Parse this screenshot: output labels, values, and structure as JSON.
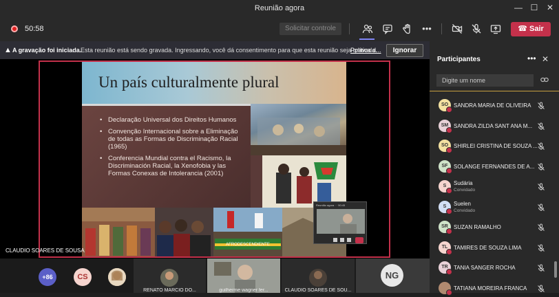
{
  "window": {
    "title": "Reunião agora",
    "minimize": "—",
    "maximize": "☐",
    "close": "✕"
  },
  "toolbar": {
    "timer": "50:58",
    "request_control": "Solicitar controle",
    "leave_label": "Sair"
  },
  "banner": {
    "bold": "A gravação foi iniciada.",
    "text": "Esta reunião está sendo gravada. Ingressando, você dá consentimento para que esta reunião seja gravada.",
    "link": "Política d...",
    "ignore": "Ignorar"
  },
  "slide": {
    "title": "Un país culturalmente plural",
    "bullets": [
      "Declaração Universal dos Direitos Humanos",
      "Convenção Internacional sobre a Eliminação de todas as Formas de Discriminação Racial (1965)",
      "Conferencia Mundial contra el Racismo, la Discriminación Racial, la Xenofobia y las Formas Conexas de Intolerancia (2001)"
    ],
    "banner_text": "AFRODESCENDIENTE"
  },
  "mini_window": {
    "title": "Reunião agora  ·  ·  50:45"
  },
  "speaker_label": "CLAUDIO SOARES DE SOUSA",
  "gallery": {
    "more_count": "+86",
    "cs": "CS",
    "ng": "NG",
    "tiles": [
      {
        "name": "RENATO MARCIO DO..."
      },
      {
        "name": "guilherme wagner fer..."
      },
      {
        "name": "CLAUDIO SOARES DE SOU..."
      }
    ]
  },
  "panel": {
    "title": "Participantes",
    "more": "•••",
    "close": "✕",
    "search_placeholder": "Digite um nome",
    "participants": [
      {
        "initials": "SO",
        "name": "SANDRA MARIA DE OLIVEIRA",
        "color": "#f4e1a1"
      },
      {
        "initials": "SM",
        "name": "SANDRA ZILDA SANT ANA M...",
        "color": "#e8d1d8"
      },
      {
        "initials": "SO",
        "name": "SHIRLEI CRISTINA DE SOUZA ...",
        "color": "#f4e1a1"
      },
      {
        "initials": "SF",
        "name": "SOLANGE FERNANDES DE A...",
        "color": "#cfe3c9"
      },
      {
        "initials": "S",
        "name": "Sudária",
        "sub": "Convidado",
        "color": "#f6d5cf"
      },
      {
        "initials": "S",
        "name": "Suelen",
        "sub": "Convidado",
        "color": "#d3dff5"
      },
      {
        "initials": "SR",
        "name": "SUZAN RAMALHO",
        "color": "#cfe3c9"
      },
      {
        "initials": "TL",
        "name": "TAMIRES DE SOUZA LIMA",
        "color": "#f6d5cf"
      },
      {
        "initials": "TR",
        "name": "TANIA SANGER ROCHA",
        "color": "#e8d1d8"
      },
      {
        "initials": "",
        "name": "TATIANA MOREIRA FRANCA",
        "color": "#b08a70"
      }
    ]
  },
  "colors": {
    "accent": "#7f85f5",
    "leave": "#c4314b",
    "recording": "#e02020"
  }
}
